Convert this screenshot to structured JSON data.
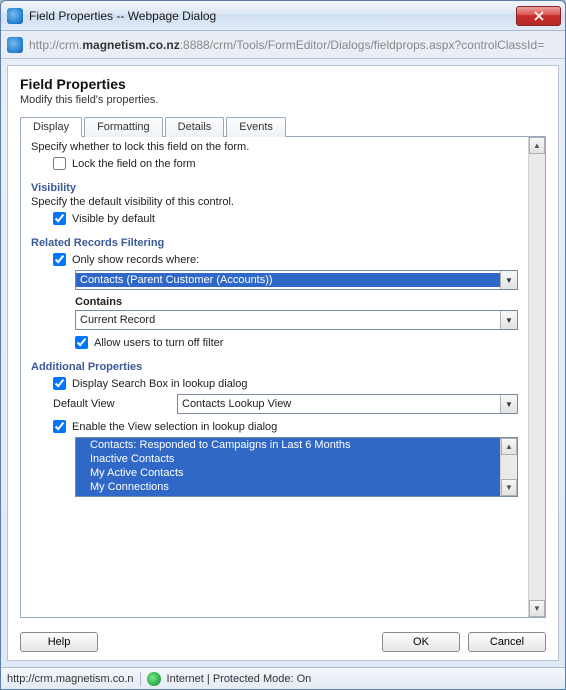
{
  "window": {
    "title": "Field Properties -- Webpage Dialog"
  },
  "address": {
    "prefix": "http://crm.",
    "host": "magnetism.co.nz",
    "rest": ":8888/crm/Tools/FormEditor/Dialogs/fieldprops.aspx?controlClassId="
  },
  "page": {
    "title": "Field Properties",
    "subtitle": "Modify this field's properties."
  },
  "tabs": {
    "display": "Display",
    "formatting": "Formatting",
    "details": "Details",
    "events": "Events"
  },
  "lock": {
    "caption": "Specify whether to lock this field on the form.",
    "checkbox_label": "Lock the field on the form",
    "checked": false
  },
  "visibility": {
    "title": "Visibility",
    "caption": "Specify the default visibility of this control.",
    "checkbox_label": "Visible by default",
    "checked": true
  },
  "related": {
    "title": "Related Records Filtering",
    "only_show_label": "Only show records where:",
    "only_show_checked": true,
    "records_where_value": "Contacts (Parent Customer (Accounts))",
    "contains_label": "Contains",
    "contains_value": "Current Record",
    "allow_off_label": "Allow users to turn off filter",
    "allow_off_checked": true
  },
  "additional": {
    "title": "Additional Properties",
    "search_box_label": "Display Search Box in lookup dialog",
    "search_box_checked": true,
    "default_view_label": "Default View",
    "default_view_value": "Contacts Lookup View",
    "enable_view_label": "Enable the View selection in lookup dialog",
    "enable_view_checked": true,
    "views": [
      "Contacts: Responded to Campaigns in Last 6 Months",
      "Inactive Contacts",
      "My Active Contacts",
      "My Connections"
    ]
  },
  "buttons": {
    "help": "Help",
    "ok": "OK",
    "cancel": "Cancel"
  },
  "status": {
    "left": "http://crm.magnetism.co.n",
    "right": "Internet | Protected Mode: On"
  }
}
